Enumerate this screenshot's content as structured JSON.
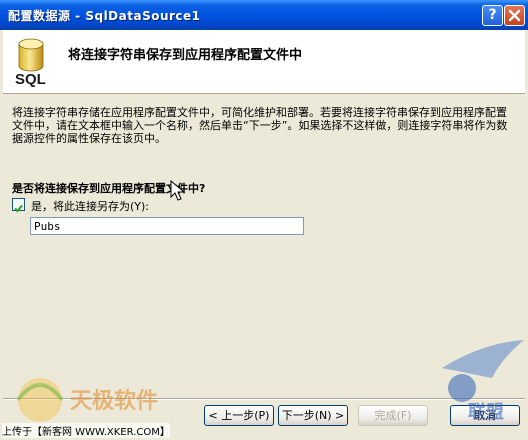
{
  "window": {
    "title": "配置数据源 - SqlDataSource1",
    "help_glyph": "?",
    "close_glyph": "×"
  },
  "header": {
    "icon_label": "SQL",
    "title": "将连接字符串保存到应用程序配置文件中"
  },
  "content": {
    "description": "将连接字符串存储在应用程序配置文件中，可简化维护和部署。若要将连接字符串保存到应用程序配置文件中，请在文本框中输入一个名称，然后单击“下一步”。如果选择不这样做，则连接字符串将作为数据源控件的属性保存在该页中。",
    "question": "是否将连接保存到应用程序配置文件中?",
    "save_checkbox_label": "是，将此连接另存为(Y):",
    "save_checked": true,
    "connection_name": "Pubs"
  },
  "buttons": {
    "prev": "< 上一步(P)",
    "next": "下一步(N) >",
    "finish": "完成(F)",
    "cancel": "取消"
  },
  "watermarks": {
    "left_logo": "天极软件",
    "caption": "上传于【新客网 WWW.XKER.COM】",
    "right_logo": "联盟"
  }
}
